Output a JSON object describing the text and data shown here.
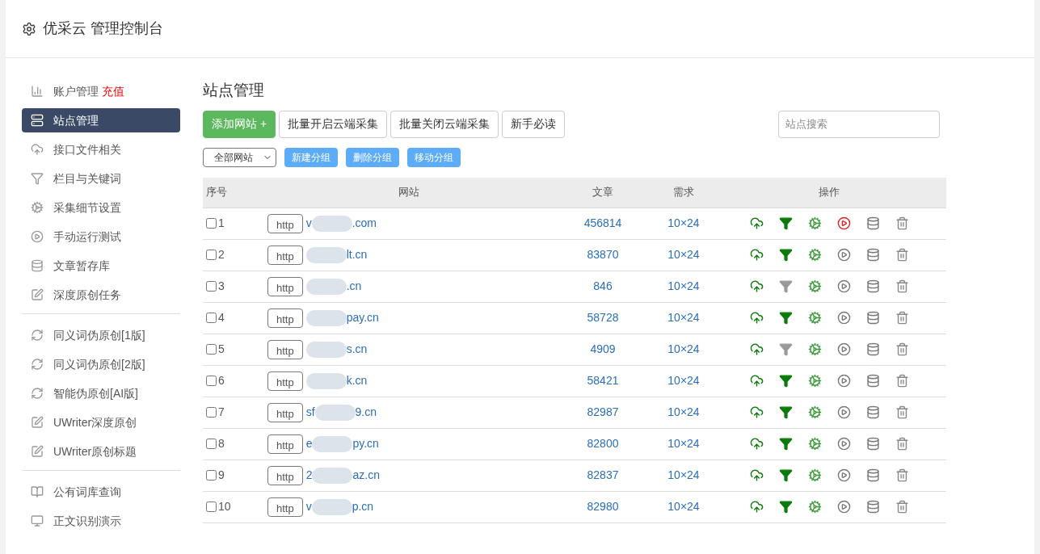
{
  "header": {
    "title": "优采云 管理控制台"
  },
  "sidebar": {
    "groups": [
      {
        "items": [
          {
            "label": "账户管理",
            "badge": "充值",
            "kind": "chart",
            "selected": false
          },
          {
            "label": "站点管理",
            "kind": "server",
            "selected": true
          },
          {
            "label": "接口文件相关",
            "kind": "cloud",
            "selected": false
          },
          {
            "label": "栏目与关键词",
            "kind": "filter",
            "selected": false
          },
          {
            "label": "采集细节设置",
            "kind": "gears",
            "selected": false
          },
          {
            "label": "手动运行测试",
            "kind": "play",
            "selected": false
          },
          {
            "label": "文章暂存库",
            "kind": "database",
            "selected": false
          },
          {
            "label": "深度原创任务",
            "kind": "edit",
            "selected": false
          }
        ]
      },
      {
        "items": [
          {
            "label": "同义词伪原创[1版]",
            "kind": "refresh",
            "selected": false
          },
          {
            "label": "同义词伪原创[2版]",
            "kind": "refresh",
            "selected": false
          },
          {
            "label": "智能伪原创[AI版]",
            "kind": "refresh",
            "selected": false
          },
          {
            "label": "UWriter深度原创",
            "kind": "edit",
            "selected": false
          },
          {
            "label": "UWriter原创标题",
            "kind": "edit",
            "selected": false
          }
        ]
      },
      {
        "items": [
          {
            "label": "公有词库查询",
            "kind": "book",
            "selected": false
          },
          {
            "label": "正文识别演示",
            "kind": "monitor",
            "selected": false
          }
        ]
      }
    ]
  },
  "main": {
    "title": "站点管理",
    "toolbar": [
      {
        "label": "添加网站 +",
        "kind": "primary"
      },
      {
        "label": "批量开启云端采集",
        "kind": "default"
      },
      {
        "label": "批量关闭云端采集",
        "kind": "default"
      },
      {
        "label": "新手必读",
        "kind": "default"
      }
    ],
    "search": {
      "placeholder": "站点搜索"
    },
    "group_select": {
      "value": "全部网站"
    },
    "group_buttons": [
      "新建分组",
      "删除分组",
      "移动分组"
    ],
    "table": {
      "columns": [
        "序号",
        "网站",
        "文章",
        "需求",
        "操作"
      ],
      "rows": [
        {
          "checked": false,
          "index": "1",
          "protocol": "http",
          "domain_start": "v",
          "domain_end": ".com",
          "articles": "456814",
          "demand": "10×24",
          "filter_on": true,
          "running": true
        },
        {
          "checked": false,
          "index": "2",
          "protocol": "http",
          "domain_start": "",
          "domain_end": "lt.cn",
          "articles": "83870",
          "demand": "10×24",
          "filter_on": true,
          "running": false
        },
        {
          "checked": false,
          "index": "3",
          "protocol": "http",
          "domain_start": "",
          "domain_end": ".cn",
          "articles": "846",
          "demand": "10×24",
          "filter_on": false,
          "running": false
        },
        {
          "checked": false,
          "index": "4",
          "protocol": "http",
          "domain_start": "",
          "domain_end": "pay.cn",
          "articles": "58728",
          "demand": "10×24",
          "filter_on": true,
          "running": false
        },
        {
          "checked": false,
          "index": "5",
          "protocol": "http",
          "domain_start": "",
          "domain_end": "s.cn",
          "articles": "4909",
          "demand": "10×24",
          "filter_on": false,
          "running": false
        },
        {
          "checked": false,
          "index": "6",
          "protocol": "http",
          "domain_start": "",
          "domain_end": "k.cn",
          "articles": "58421",
          "demand": "10×24",
          "filter_on": true,
          "running": false
        },
        {
          "checked": false,
          "index": "7",
          "protocol": "http",
          "domain_start": "sf",
          "domain_end": "9.cn",
          "articles": "82987",
          "demand": "10×24",
          "filter_on": true,
          "running": false
        },
        {
          "checked": false,
          "index": "8",
          "protocol": "http",
          "domain_start": "e",
          "domain_end": "py.cn",
          "articles": "82800",
          "demand": "10×24",
          "filter_on": true,
          "running": false
        },
        {
          "checked": false,
          "index": "9",
          "protocol": "http",
          "domain_start": "2",
          "domain_end": "az.cn",
          "articles": "82837",
          "demand": "10×24",
          "filter_on": true,
          "running": false
        },
        {
          "checked": false,
          "index": "10",
          "protocol": "http",
          "domain_start": "v",
          "domain_end": "p.cn",
          "articles": "82980",
          "demand": "10×24",
          "filter_on": true,
          "running": false
        }
      ]
    }
  }
}
